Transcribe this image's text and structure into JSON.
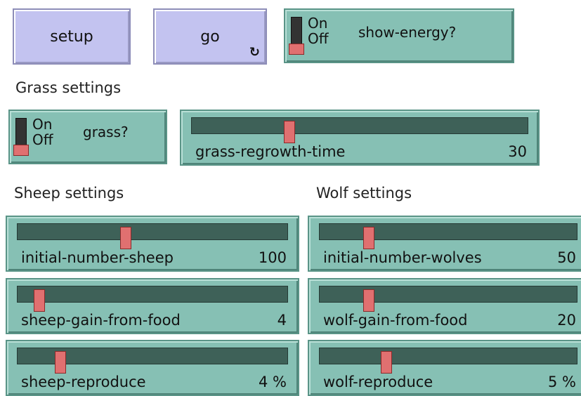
{
  "buttons": {
    "setup": {
      "label": "setup"
    },
    "go": {
      "label": "go",
      "icon": "forever-icon",
      "icon_glyph": "↻"
    }
  },
  "show_energy": {
    "on": "On",
    "off": "Off",
    "label": "show-energy?",
    "state": "off"
  },
  "grass_section": {
    "title": "Grass settings",
    "switch": {
      "on": "On",
      "off": "Off",
      "label": "grass?",
      "state": "off"
    },
    "regrowth": {
      "name": "grass-regrowth-time",
      "value": "30",
      "fraction": 0.29
    }
  },
  "sheep_section": {
    "title": "Sheep settings",
    "initial": {
      "name": "initial-number-sheep",
      "value": "100",
      "fraction": 0.4
    },
    "gain": {
      "name": "sheep-gain-from-food",
      "value": "4",
      "fraction": 0.08
    },
    "reproduce": {
      "name": "sheep-reproduce",
      "value": "4 %",
      "fraction": 0.16
    }
  },
  "wolf_section": {
    "title": "Wolf settings",
    "initial": {
      "name": "initial-number-wolves",
      "value": "50",
      "fraction": 0.19
    },
    "gain": {
      "name": "wolf-gain-from-food",
      "value": "20",
      "fraction": 0.19
    },
    "reproduce": {
      "name": "wolf-reproduce",
      "value": "5 %",
      "fraction": 0.26
    }
  },
  "colors": {
    "button_bg": "#c3c3f0",
    "widget_bg": "#86c0b4",
    "track": "#3e6158",
    "thumb": "#e07070"
  }
}
